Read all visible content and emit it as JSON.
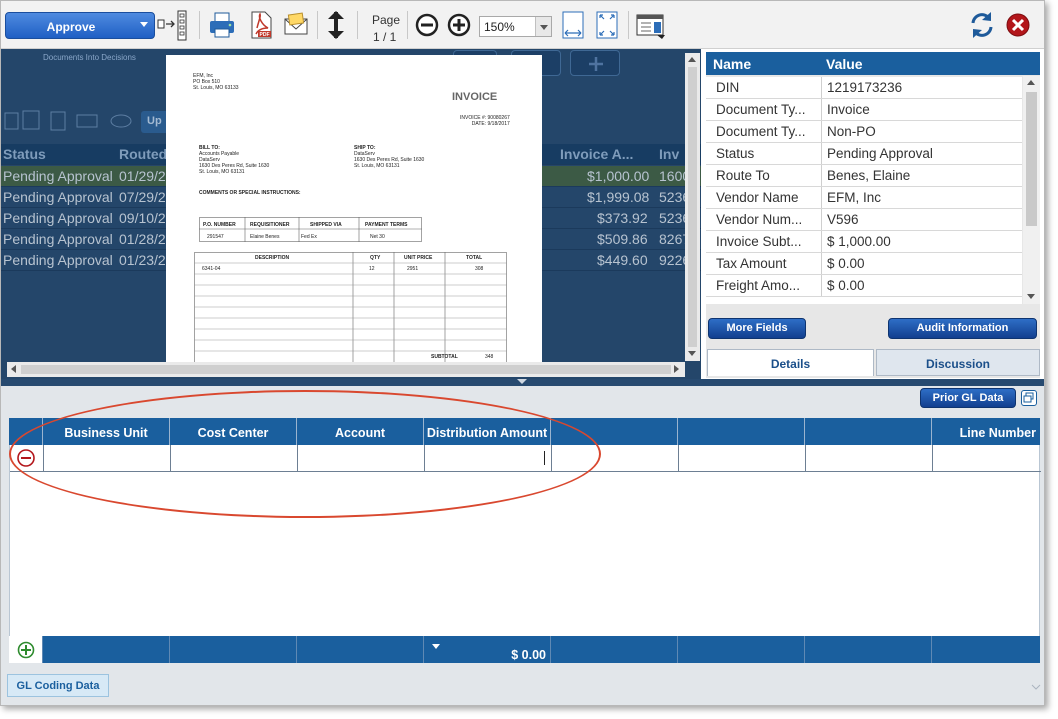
{
  "toolbar": {
    "approve_label": "Approve",
    "page_label": "Page",
    "page_value": "1 / 1",
    "zoom_value": "150%"
  },
  "background_app": {
    "subtitle": "Documents Into Decisions",
    "button_partial": "Up",
    "columns": [
      "Status",
      "Routed",
      "Invoice A...",
      "Inv"
    ],
    "rows": [
      {
        "status": "Pending Approval",
        "routed": "01/29/2",
        "amount": "$1,000.00",
        "inv": "1600"
      },
      {
        "status": "Pending Approval",
        "routed": "07/29/2",
        "amount": "$1,999.08",
        "inv": "5236"
      },
      {
        "status": "Pending Approval",
        "routed": "09/10/2",
        "amount": "$373.92",
        "inv": "5236"
      },
      {
        "status": "Pending Approval",
        "routed": "01/28/2",
        "amount": "$509.86",
        "inv": "8267"
      },
      {
        "status": "Pending Approval",
        "routed": "01/23/2",
        "amount": "$449.60",
        "inv": "9226"
      }
    ]
  },
  "document": {
    "vendor_lines": "EFM, Inc\nPO Box 510\nSt. Louis, MO 63133",
    "title": "INVOICE",
    "invoice_meta": "INVOICE #: 90080267\nDATE: 9/18/2017",
    "bill_to_label": "BILL TO:",
    "bill_to": "Accounts Payable\nDataServ\n1630 Des Peres Rd, Suite 1630\nSt. Louis, MO 63131",
    "ship_to_label": "SHIP TO:",
    "ship_to": "DataServ\n1630 Des Peres Rd, Suite 1630\nSt. Louis, MO 63131",
    "comments_label": "COMMENTS OR SPECIAL INSTRUCTIONS:",
    "po_headers": [
      "P.O. NUMBER",
      "REQUISITIONER",
      "SHIPPED VIA",
      "PAYMENT TERMS"
    ],
    "po_values": [
      "291547",
      "Elaine Benes",
      "Fed Ex",
      "Net 30"
    ],
    "line_headers": [
      "DESCRIPTION",
      "QTY",
      "UNIT PRICE",
      "TOTAL"
    ],
    "line_values": [
      "6341-04",
      "12",
      "2951",
      "308"
    ],
    "subtotal_label": "SUBTOTAL",
    "subtotal_value": "348"
  },
  "properties": {
    "col_name": "Name",
    "col_value": "Value",
    "rows": [
      {
        "name": "DIN",
        "value": "1219173236"
      },
      {
        "name": "Document Ty...",
        "value": "Invoice"
      },
      {
        "name": "Document Ty...",
        "value": "Non-PO"
      },
      {
        "name": "Status",
        "value": "Pending Approval"
      },
      {
        "name": "Route To",
        "value": "Benes, Elaine"
      },
      {
        "name": "Vendor Name",
        "value": "EFM, Inc"
      },
      {
        "name": "Vendor Num...",
        "value": "V596"
      },
      {
        "name": "Invoice Subt...",
        "value": "$ 1,000.00"
      },
      {
        "name": "Tax Amount",
        "value": "$ 0.00"
      },
      {
        "name": "Freight Amo...",
        "value": "$ 0.00"
      }
    ],
    "more_fields": "More Fields",
    "audit_information": "Audit Information",
    "tab_details": "Details",
    "tab_discussion": "Discussion"
  },
  "gl": {
    "prior_gl_data": "Prior GL Data",
    "columns": [
      "Business Unit",
      "Cost Center",
      "Account",
      "Distribution Amount",
      "",
      "",
      "",
      "Line Number"
    ],
    "total": "$ 0.00",
    "bottom_tab": "GL Coding Data"
  },
  "colors": {
    "header_blue": "#1a5f9e",
    "annotation_red": "#d9482f",
    "approve_blue": "#2a6ad0"
  },
  "icons": [
    "printer-icon",
    "pdf-icon",
    "email-icon",
    "fit-height-icon",
    "zoom-out-icon",
    "zoom-in-icon",
    "fit-width-icon",
    "fit-page-icon",
    "layout-icon",
    "refresh-icon",
    "close-icon"
  ]
}
